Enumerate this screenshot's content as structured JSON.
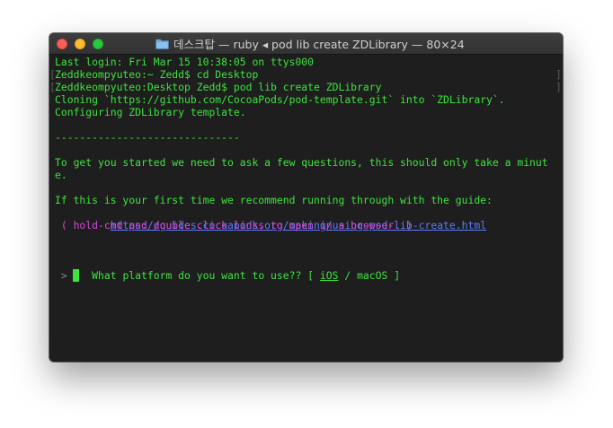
{
  "window": {
    "title": "데스크탑 — ruby ◂ pod lib create ZDLibrary — 80×24"
  },
  "colors": {
    "terminal_bg": "#1e1e1e",
    "text_green": "#3ee33e",
    "text_magenta": "#d946d9",
    "link_blue": "#5b7bff"
  },
  "terminal": {
    "l1": "Last login: Fri Mar 15 10:38:05 on ttys000",
    "l2": "Zeddkeompyuteo:~ Zedd$ cd Desktop",
    "l3": "Zeddkeompyuteo:Desktop Zedd$ pod lib create ZDLibrary",
    "l4": "Cloning `https://github.com/CocoaPods/pod-template.git` into `ZDLibrary`.",
    "l5": "Configuring ZDLibrary template.",
    "l6": "------------------------------",
    "l7": "To get you started we need to ask a few questions, this should only take a minut",
    "l8": "e.",
    "l9": "If this is your first time we recommend running through with the guide:",
    "l10_prefix": " - ",
    "l10_link": "https://guides.cocoapods.org/making/using-pod-lib-create.html",
    "l11": " ( hold cmd and double click links to open in a browser. )",
    "l12_prefix": "What platform do you want to use?? [ ",
    "l12_ios": "iOS",
    "l12_sep": " / ",
    "l12_macos": "macOS",
    "l12_suffix": " ]",
    "prompt": " > "
  }
}
